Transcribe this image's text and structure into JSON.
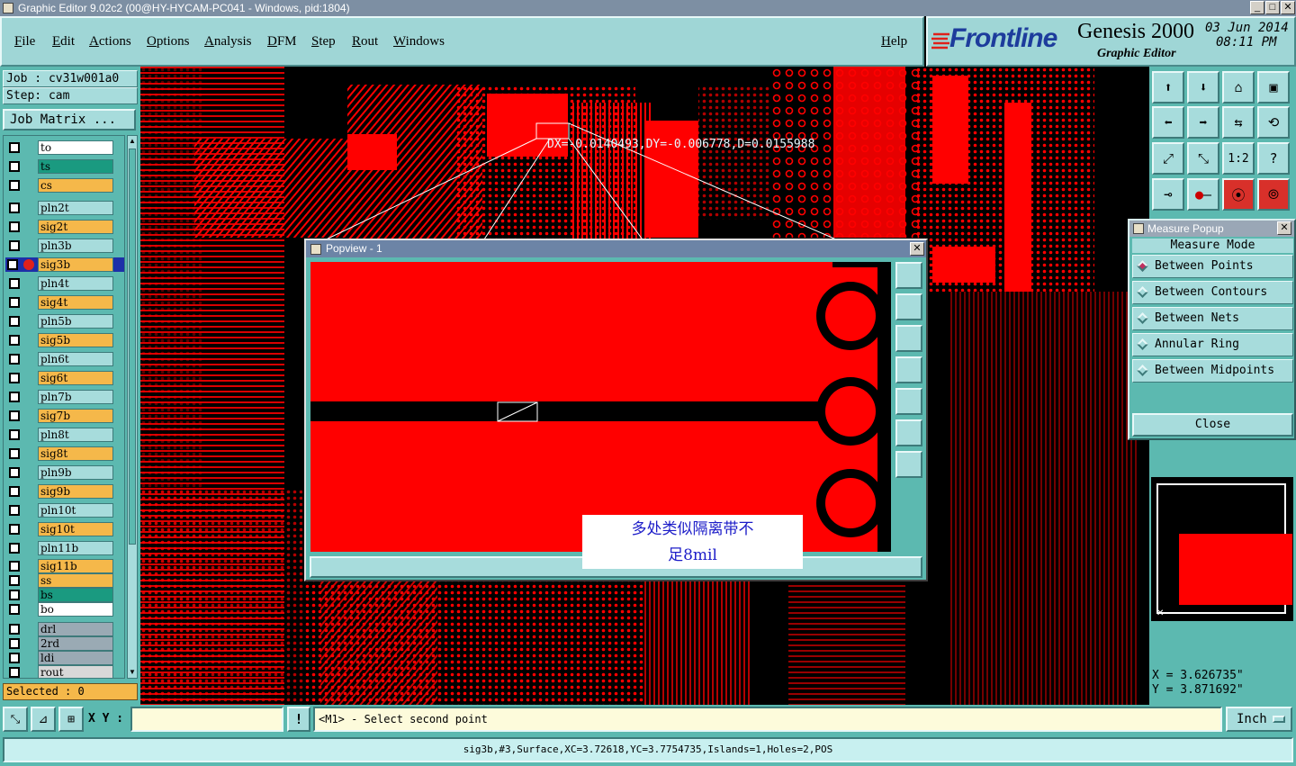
{
  "window": {
    "title": "Graphic Editor 9.02c2 (00@HY-HYCAM-PC041 - Windows, pid:1804)"
  },
  "menu": [
    {
      "label": "File",
      "u": "F",
      "rest": "ile"
    },
    {
      "label": "Edit",
      "u": "E",
      "rest": "dit"
    },
    {
      "label": "Actions",
      "u": "A",
      "rest": "ctions"
    },
    {
      "label": "Options",
      "u": "O",
      "rest": "ptions"
    },
    {
      "label": "Analysis",
      "u": "A",
      "rest": "nalysis"
    },
    {
      "label": "DFM",
      "u": "D",
      "rest": "FM"
    },
    {
      "label": "Step",
      "u": "S",
      "rest": "tep"
    },
    {
      "label": "Rout",
      "u": "R",
      "rest": "out"
    },
    {
      "label": "Windows",
      "u": "W",
      "rest": "indows"
    }
  ],
  "help": {
    "u": "H",
    "rest": "elp"
  },
  "logo": {
    "brand": "Frontline",
    "product": "Genesis 2000",
    "subtitle": "Graphic Editor",
    "date": "03 Jun 2014",
    "time": "08:11 PM"
  },
  "job": {
    "job_line": "Job : cv31w001a0",
    "step_line": "Step: cam",
    "job_matrix": "Job Matrix ..."
  },
  "layers": [
    {
      "name": "to",
      "color": "#ffffff"
    },
    {
      "name": "ts",
      "color": "#1a9a80"
    },
    {
      "name": "cs",
      "color": "#f5b84a"
    },
    {
      "name": "pln2t",
      "color": "#a7dcdc"
    },
    {
      "name": "sig2t",
      "color": "#f5b84a"
    },
    {
      "name": "pln3b",
      "color": "#a7dcdc"
    },
    {
      "name": "sig3b",
      "color": "#f5b84a"
    },
    {
      "name": "pln4t",
      "color": "#a7dcdc"
    },
    {
      "name": "sig4t",
      "color": "#f5b84a"
    },
    {
      "name": "pln5b",
      "color": "#a7dcdc"
    },
    {
      "name": "sig5b",
      "color": "#f5b84a"
    },
    {
      "name": "pln6t",
      "color": "#a7dcdc"
    },
    {
      "name": "sig6t",
      "color": "#f5b84a"
    },
    {
      "name": "pln7b",
      "color": "#a7dcdc"
    },
    {
      "name": "sig7b",
      "color": "#f5b84a"
    },
    {
      "name": "pln8t",
      "color": "#a7dcdc"
    },
    {
      "name": "sig8t",
      "color": "#f5b84a"
    },
    {
      "name": "pln9b",
      "color": "#a7dcdc"
    },
    {
      "name": "sig9b",
      "color": "#f5b84a"
    },
    {
      "name": "pln10t",
      "color": "#a7dcdc"
    },
    {
      "name": "sig10t",
      "color": "#f5b84a"
    },
    {
      "name": "pln11b",
      "color": "#a7dcdc"
    },
    {
      "name": "sig11b",
      "color": "#f5b84a"
    },
    {
      "name": "ss",
      "color": "#f5b84a"
    },
    {
      "name": "bs",
      "color": "#1a9a80"
    },
    {
      "name": "bo",
      "color": "#ffffff"
    },
    {
      "name": "drl",
      "color": "#9aaab4"
    },
    {
      "name": "2rd",
      "color": "#9aaab4"
    },
    {
      "name": "ldi",
      "color": "#9aaab4"
    },
    {
      "name": "rout",
      "color": "#d8d8d8"
    }
  ],
  "selected": "Selected : 0",
  "measurement": "DX=-0.0140493,DY=-0.006778,D=0.0155988",
  "popview": {
    "title": "Popview - 1"
  },
  "annotation": {
    "line1": "多处类似隔离带不",
    "line2": "足8mil"
  },
  "measure_popup": {
    "title": "Measure Popup",
    "mode_label": "Measure Mode",
    "options": [
      {
        "label": "Between Points",
        "selected": true
      },
      {
        "label": "Between Contours",
        "selected": false
      },
      {
        "label": "Between Nets",
        "selected": false
      },
      {
        "label": "Annular Ring",
        "selected": false
      },
      {
        "label": "Between Midpoints",
        "selected": false
      }
    ],
    "close_label": "Close"
  },
  "coords": {
    "x": "X = 3.626735\"",
    "y": "Y = 3.871692\""
  },
  "command": {
    "xy_label": "X Y :",
    "xy_value": "",
    "prompt": "<M1> - Select second point",
    "units": "Inch"
  },
  "status": "sig3b,#3,Surface,XC=3.72618,YC=3.7754735,Islands=1,Holes=2,POS",
  "colors": {
    "copper": "#ff0000",
    "panel": "#5cb9b0",
    "light": "#a7dcdc",
    "highlight": "#f5b84a"
  }
}
